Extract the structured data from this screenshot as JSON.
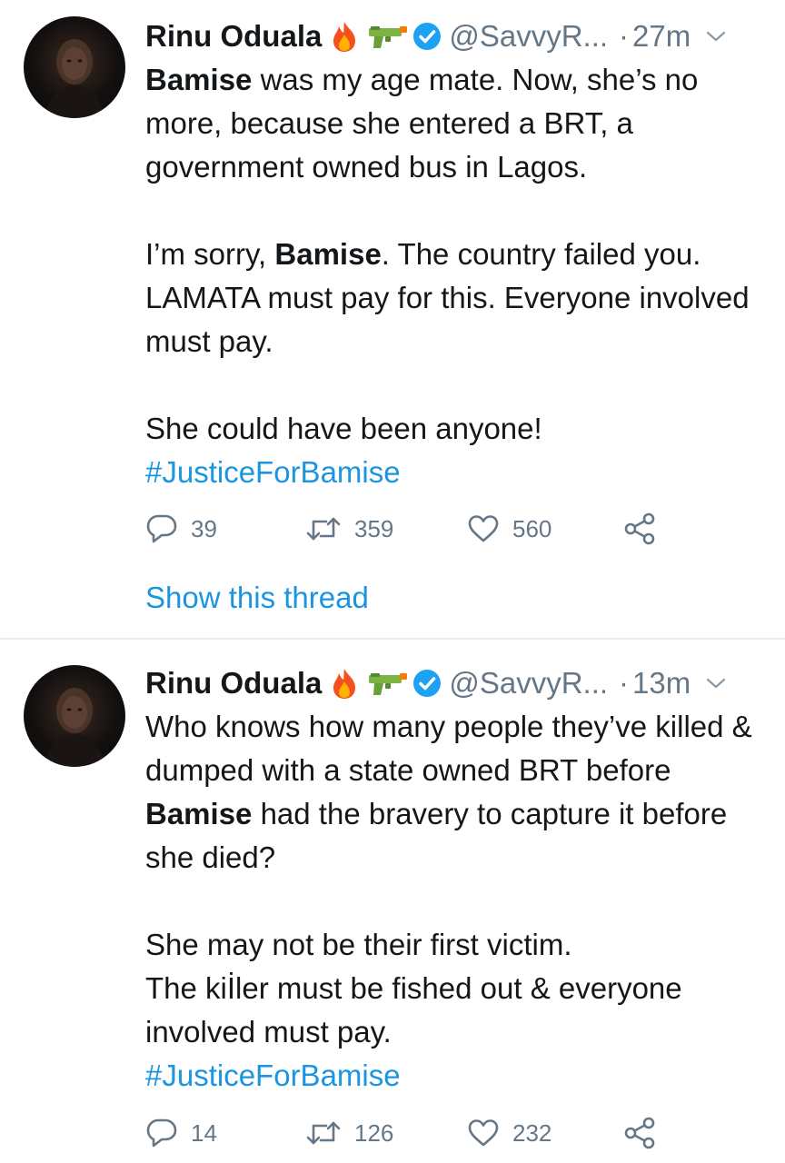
{
  "colors": {
    "link": "#1b95e0",
    "secondary_text": "#657786",
    "primary_text": "#14171a",
    "verified_badge": "#1da1f2",
    "divider": "#e6ecf0"
  },
  "tweets": [
    {
      "author": {
        "name": "Rinu Oduala",
        "handle": "@SavvyR...",
        "emojis": [
          "fire-emoji",
          "water-gun-emoji"
        ],
        "verified": true
      },
      "time": "27m",
      "dot": "·",
      "body": {
        "p1_bold": "Bamise",
        "p1_rest": " was my age mate. Now, she’s no more, because she entered a BRT, a government owned bus in Lagos.",
        "p2_pre": "I’m sorry, ",
        "p2_bold": "Bamise",
        "p2_rest": ". The country failed you. LAMATA must pay for this. Everyone involved must pay.",
        "p3": "She could have been anyone!",
        "hashtag": "#JusticeForBamise"
      },
      "counts": {
        "replies": "39",
        "retweets": "359",
        "likes": "560"
      },
      "show_thread": "Show this thread"
    },
    {
      "author": {
        "name": "Rinu Oduala",
        "handle": "@SavvyR...",
        "emojis": [
          "fire-emoji",
          "water-gun-emoji"
        ],
        "verified": true
      },
      "time": "13m",
      "dot": "·",
      "body": {
        "p1_pre": "Who knows how many people they’ve killed & dumped with a state owned BRT before ",
        "p1_bold": "Bamise",
        "p1_rest": " had the bravery to capture it before she died?",
        "p2_line1": "She may not be their first victim.",
        "p2_line2": "The kiİler must be fished out & everyone involved must pay.",
        "hashtag": "#JusticeForBamise"
      },
      "counts": {
        "replies": "14",
        "retweets": "126",
        "likes": "232"
      }
    }
  ]
}
